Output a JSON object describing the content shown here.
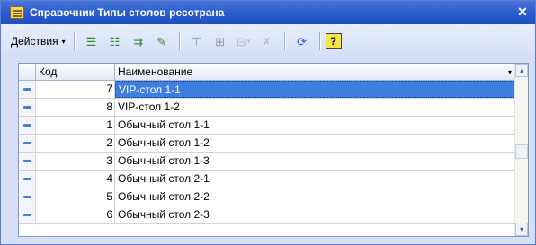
{
  "window": {
    "title": "Справочник Типы столов ресотрана",
    "close_glyph": "✕"
  },
  "toolbar": {
    "actions_label": "Действия",
    "actions_arrow": "▾",
    "buttons": [
      {
        "icon": "add-row-icon",
        "glyph": "☰"
      },
      {
        "icon": "add-group-icon",
        "glyph": "☷"
      },
      {
        "icon": "copy-row-icon",
        "glyph": "⇉"
      },
      {
        "icon": "edit-row-icon",
        "glyph": "✎"
      },
      {
        "icon": "filter-icon",
        "glyph": "⊤"
      },
      {
        "icon": "hierarchy-icon",
        "glyph": "⊞"
      },
      {
        "icon": "filter-dropdown-icon",
        "glyph": "⊟"
      },
      {
        "icon": "clear-filter-icon",
        "glyph": "✗"
      },
      {
        "icon": "refresh-icon",
        "glyph": "⟳"
      }
    ],
    "help_label": "?"
  },
  "grid": {
    "columns": {
      "code": "Код",
      "name": "Наименование"
    },
    "sort_glyph": "▾",
    "rows": [
      {
        "code": "7",
        "name": "VIP-стол 1-1",
        "selected": true
      },
      {
        "code": "8",
        "name": "VIP-стол 1-2",
        "selected": false
      },
      {
        "code": "1",
        "name": "Обычный стол 1-1",
        "selected": false
      },
      {
        "code": "2",
        "name": "Обычный стол 1-2",
        "selected": false
      },
      {
        "code": "3",
        "name": "Обычный стол 1-3",
        "selected": false
      },
      {
        "code": "4",
        "name": "Обычный стол 2-1",
        "selected": false
      },
      {
        "code": "5",
        "name": "Обычный стол 2-2",
        "selected": false
      },
      {
        "code": "6",
        "name": "Обычный стол 2-3",
        "selected": false
      }
    ],
    "scroll_up": "▴",
    "scroll_down": "▾"
  },
  "colors": {
    "titlebar": "#2d5fd0",
    "selection": "#3d7ee0",
    "row_marker": "#4a7fd6"
  }
}
